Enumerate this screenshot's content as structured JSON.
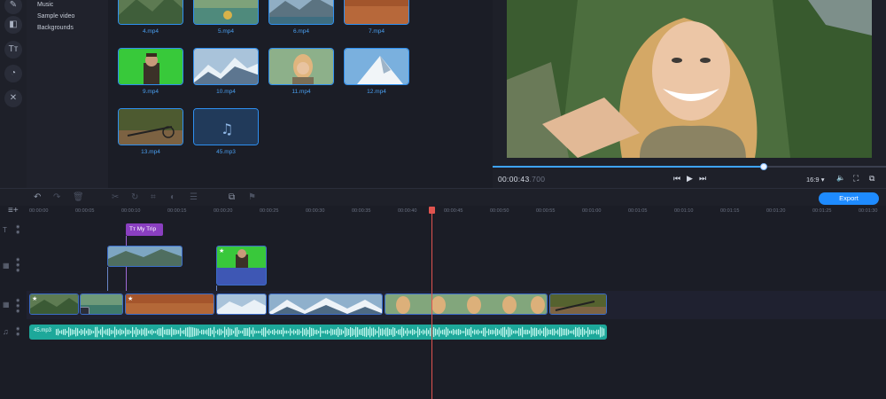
{
  "sidebar": {
    "categories": [
      "Music",
      "Sample video",
      "Backgrounds"
    ]
  },
  "library": {
    "items": [
      {
        "label": "4.mp4",
        "thumb": "mountains"
      },
      {
        "label": "5.mp4",
        "thumb": "lake"
      },
      {
        "label": "6.mp4",
        "thumb": "alpine-lake"
      },
      {
        "label": "7.mp4",
        "thumb": "desert"
      },
      {
        "label": "9.mp4",
        "thumb": "greenscreen-man"
      },
      {
        "label": "10.mp4",
        "thumb": "snowy-peaks"
      },
      {
        "label": "11.mp4",
        "thumb": "selfie-woman"
      },
      {
        "label": "12.mp4",
        "thumb": "snow-mountain"
      },
      {
        "label": "13.mp4",
        "thumb": "bike-ride"
      },
      {
        "label": "45.mp3",
        "thumb": "music-note-icon"
      }
    ]
  },
  "preview": {
    "timecode": "00:00:43",
    "timecode_ms": ".700",
    "aspect_ratio": "16:9",
    "progress": 0.69
  },
  "toolbar": {
    "export_label": "Export"
  },
  "ruler": {
    "ticks": [
      "00:00:00",
      "00:00:05",
      "00:00:10",
      "00:00:15",
      "00:00:20",
      "00:00:25",
      "00:00:30",
      "00:00:35",
      "00:00:40",
      "00:00:45",
      "00:00:50",
      "00:00:55",
      "00:01:00",
      "00:01:05",
      "00:01:10",
      "00:01:15",
      "00:01:20",
      "00:01:25",
      "00:01:30"
    ]
  },
  "timeline": {
    "title_clip": "My Trip",
    "audio_clip": "45.mp3"
  },
  "colors": {
    "accent": "#1e8bff",
    "title_clip": "#8a3fc0",
    "audio_clip": "#1da89a",
    "playhead": "#e0544f"
  }
}
